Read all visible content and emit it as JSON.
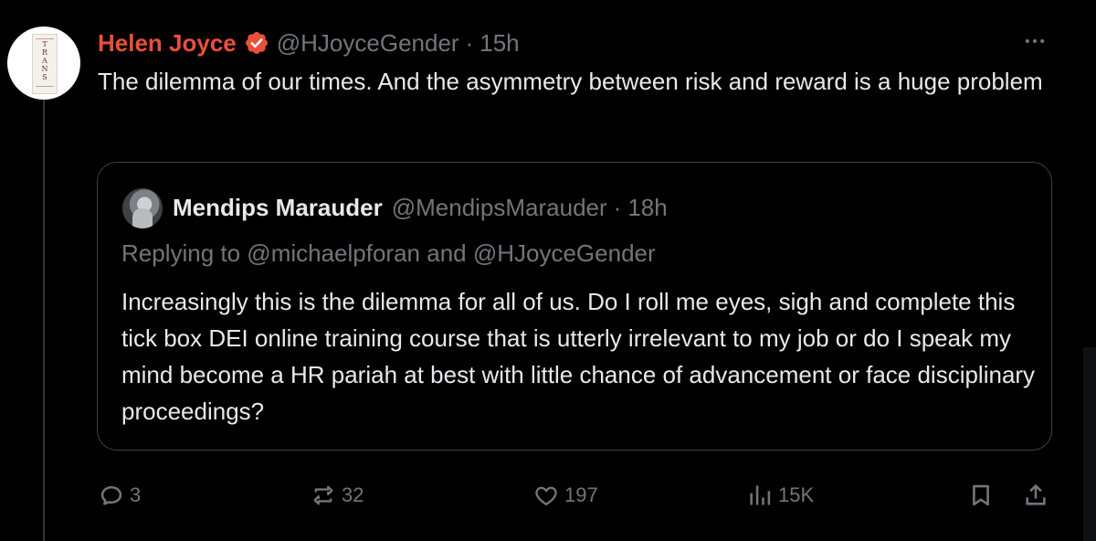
{
  "post": {
    "author_name": "Helen Joyce",
    "handle": "@HJoyceGender",
    "separator": "·",
    "time": "15h",
    "text": "The dilemma of our times. And the asymmetry between risk and reward is a huge problem",
    "avatar_label": "TRANS",
    "icons": {
      "verified": "verified-badge-icon",
      "more": "more-icon"
    }
  },
  "quote": {
    "author_name": "Mendips Marauder",
    "handle": "@MendipsMarauder",
    "separator": "·",
    "time": "18h",
    "replying_to": "Replying to @michaelpforan and @HJoyceGender",
    "text": "Increasingly this is the dilemma for all of us. Do I roll me eyes, sigh and complete this tick box DEI online training course that is utterly irrelevant to my job or do I speak my mind become a HR pariah at best with little chance of advancement or face disciplinary proceedings?"
  },
  "actions": {
    "replies": "3",
    "reposts": "32",
    "likes": "197",
    "views": "15K",
    "icons": [
      "reply-icon",
      "repost-icon",
      "like-icon",
      "views-icon",
      "bookmark-icon",
      "share-icon"
    ]
  },
  "colors": {
    "background": "#000000",
    "text": "#e7e9ea",
    "secondary_text": "#71767b",
    "author_name": "#e8503a",
    "verified_badge": "#e8503a",
    "border": "#3e4144"
  }
}
